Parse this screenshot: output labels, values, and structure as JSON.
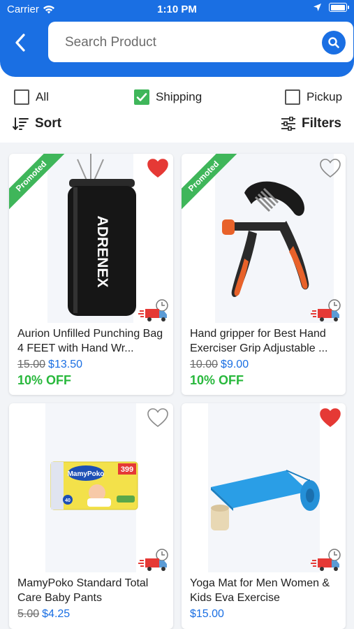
{
  "status_bar": {
    "carrier": "Carrier",
    "time": "1:10 PM",
    "battery_level": 1.0
  },
  "search": {
    "placeholder": "Search Product",
    "value": ""
  },
  "filters": {
    "options": [
      {
        "label": "All",
        "checked": false
      },
      {
        "label": "Shipping",
        "checked": true
      },
      {
        "label": "Pickup",
        "checked": false
      }
    ],
    "sort_label": "Sort",
    "filter_label": "Filters"
  },
  "products": [
    {
      "title": "Aurion Unfilled Punching Bag 4 FEET with Hand Wr...",
      "old_price": "15.00",
      "price": "$13.50",
      "discount": "10% OFF",
      "promoted": true,
      "promo_label": "Promoted",
      "favorite": true,
      "brand_text": "ADRENEX"
    },
    {
      "title": "Hand gripper for Best Hand Exerciser Grip Adjustable ...",
      "old_price": "10.00",
      "price": "$9.00",
      "discount": "10% OFF",
      "promoted": true,
      "promo_label": "Promoted",
      "favorite": false
    },
    {
      "title": "MamyPoko Standard Total Care Baby Pants",
      "old_price": "5.00",
      "price": "$4.25",
      "discount": "",
      "promoted": false,
      "favorite": false,
      "brand_text": "MamyPoko",
      "pack_text": "399",
      "count_text": "40"
    },
    {
      "title": "Yoga Mat for Men Women & Kids Eva Exercise",
      "old_price": "",
      "price": "$15.00",
      "discount": "",
      "promoted": false,
      "favorite": true
    }
  ],
  "colors": {
    "primary": "#1a6fe3",
    "green": "#3fb65a",
    "heart_red": "#e53935",
    "discount_green": "#28b83c"
  },
  "icons": [
    "back-arrow-icon",
    "search-icon",
    "wifi-icon",
    "location-arrow-icon",
    "battery-icon",
    "sort-icon",
    "filter-sliders-icon",
    "heart-icon",
    "delivery-truck-icon",
    "checkmark-icon"
  ]
}
